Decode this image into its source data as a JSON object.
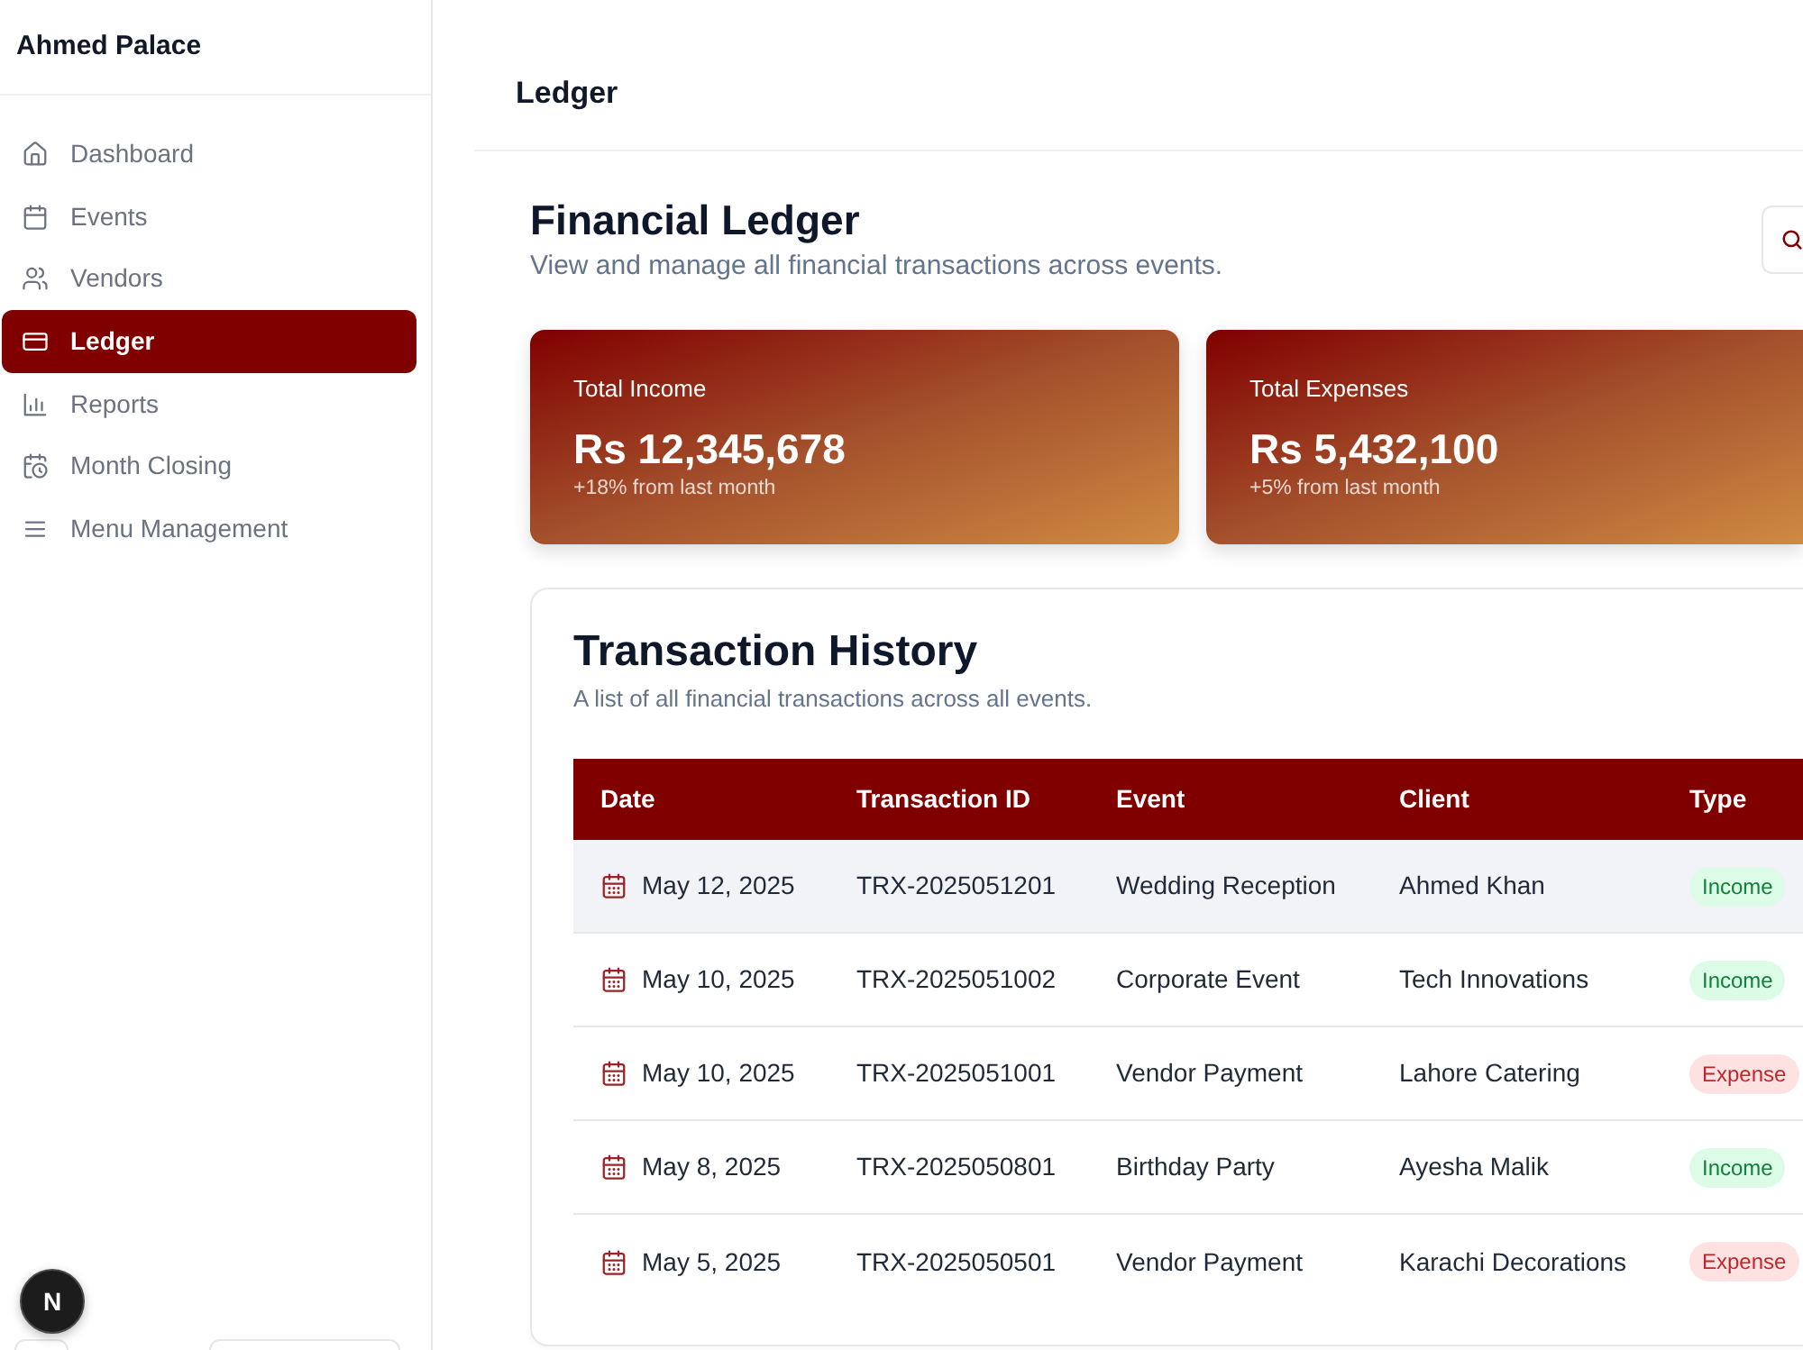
{
  "sidebar": {
    "brand": "Ahmed Palace",
    "items": [
      {
        "label": "Dashboard",
        "selected": false
      },
      {
        "label": "Events",
        "selected": false
      },
      {
        "label": "Vendors",
        "selected": false
      },
      {
        "label": "Ledger",
        "selected": true
      },
      {
        "label": "Reports",
        "selected": false
      },
      {
        "label": "Month Closing",
        "selected": false
      },
      {
        "label": "Menu Management",
        "selected": false
      }
    ]
  },
  "dev_indicator": {
    "label": "N"
  },
  "header": {
    "title": "Ledger"
  },
  "page": {
    "title": "Financial Ledger",
    "subtitle": "View and manage all financial transactions across events."
  },
  "stats": [
    {
      "label": "Total Income",
      "value": "Rs 12,345,678",
      "note": "+18% from last month"
    },
    {
      "label": "Total Expenses",
      "value": "Rs 5,432,100",
      "note": "+5% from last month"
    }
  ],
  "transactions": {
    "title": "Transaction History",
    "subtitle": "A list of all financial transactions across all events.",
    "columns": [
      "Date",
      "Transaction ID",
      "Event",
      "Client",
      "Type"
    ],
    "rows": [
      {
        "date": "May 12, 2025",
        "id": "TRX-2025051201",
        "event": "Wedding Reception",
        "client": "Ahmed Khan",
        "type": "Income",
        "kind": "income",
        "hovered": true
      },
      {
        "date": "May 10, 2025",
        "id": "TRX-2025051002",
        "event": "Corporate Event",
        "client": "Tech Innovations",
        "type": "Income",
        "kind": "income",
        "hovered": false
      },
      {
        "date": "May 10, 2025",
        "id": "TRX-2025051001",
        "event": "Vendor Payment",
        "client": "Lahore Catering",
        "type": "Expense",
        "kind": "expense",
        "hovered": false
      },
      {
        "date": "May 8, 2025",
        "id": "TRX-2025050801",
        "event": "Birthday Party",
        "client": "Ayesha Malik",
        "type": "Income",
        "kind": "income",
        "hovered": false
      },
      {
        "date": "May 5, 2025",
        "id": "TRX-2025050501",
        "event": "Vendor Payment",
        "client": "Karachi Decorations",
        "type": "Expense",
        "kind": "expense",
        "hovered": false
      }
    ]
  }
}
